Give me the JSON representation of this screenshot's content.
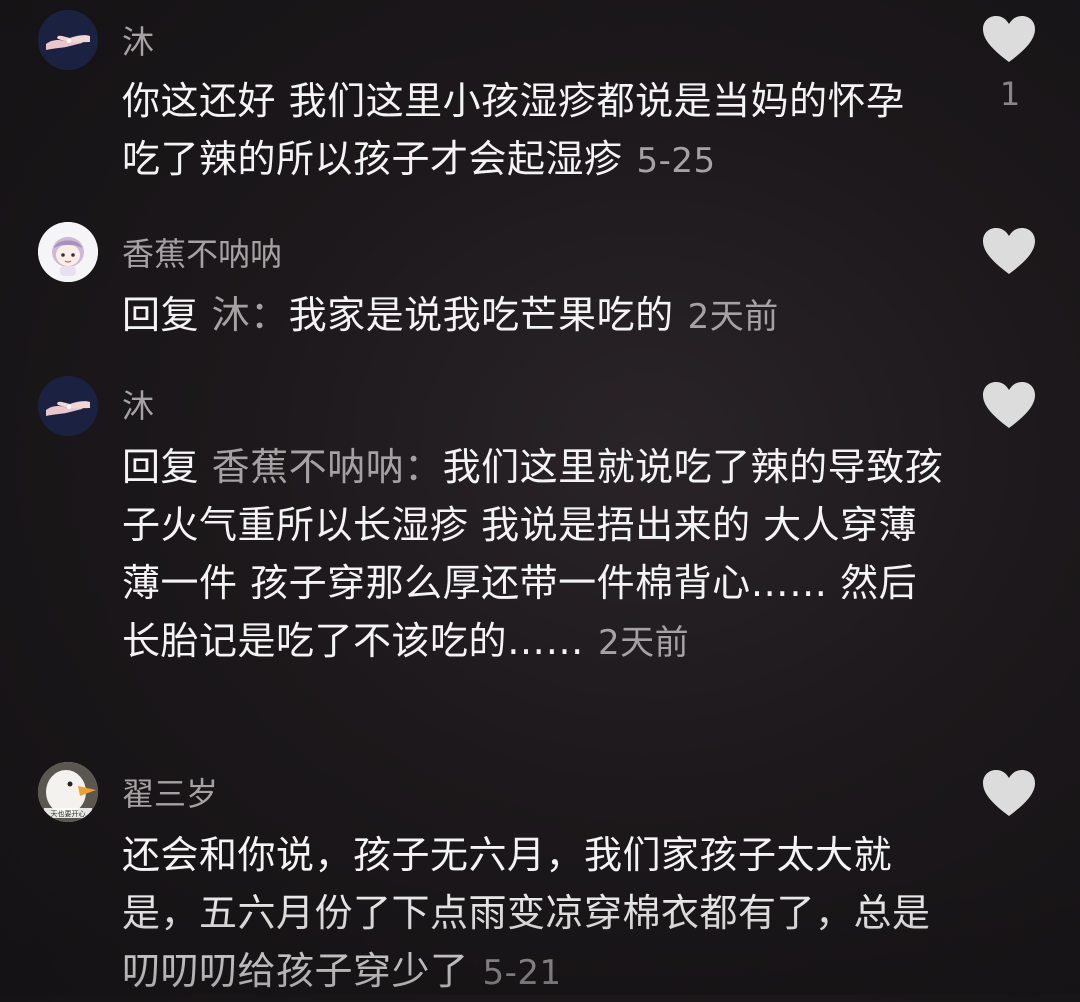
{
  "comments": [
    {
      "username": "沐",
      "text": "你这还好 我们这里小孩湿疹都说是当妈的怀孕吃了辣的所以孩子才会起湿疹",
      "time": "5-25",
      "likes": "1",
      "avatar_icon": "hands-avatar-icon"
    },
    {
      "username": "香蕉不呐呐",
      "reply_prefix": "回复",
      "reply_target": "沐：",
      "text": "我家是说我吃芒果吃的",
      "time": "2天前",
      "avatar_icon": "cartoon-girl-avatar-icon"
    },
    {
      "username": "沐",
      "reply_prefix": "回复",
      "reply_target": "香蕉不呐呐：",
      "text": "我们这里就说吃了辣的导致孩子火气重所以长湿疹 我说是捂出来的 大人穿薄薄一件 孩子穿那么厚还带一件棉背心…… 然后长胎记是吃了不该吃的……",
      "time": "2天前",
      "avatar_icon": "hands-avatar-icon"
    },
    {
      "username": "翟三岁",
      "text": "还会和你说，孩子无六月，我们家孩子太大就是，五六月份了下点雨变凉穿棉衣都有了，总是叨叨叨给孩子穿少了",
      "time": "5-21",
      "avatar_icon": "goose-avatar-icon",
      "avatar_caption": "天也要开心"
    }
  ],
  "colors": {
    "background": "#1c181b",
    "text": "#f4f4f4",
    "muted": "#a6a2a4",
    "heart": "#dcdcdc"
  }
}
